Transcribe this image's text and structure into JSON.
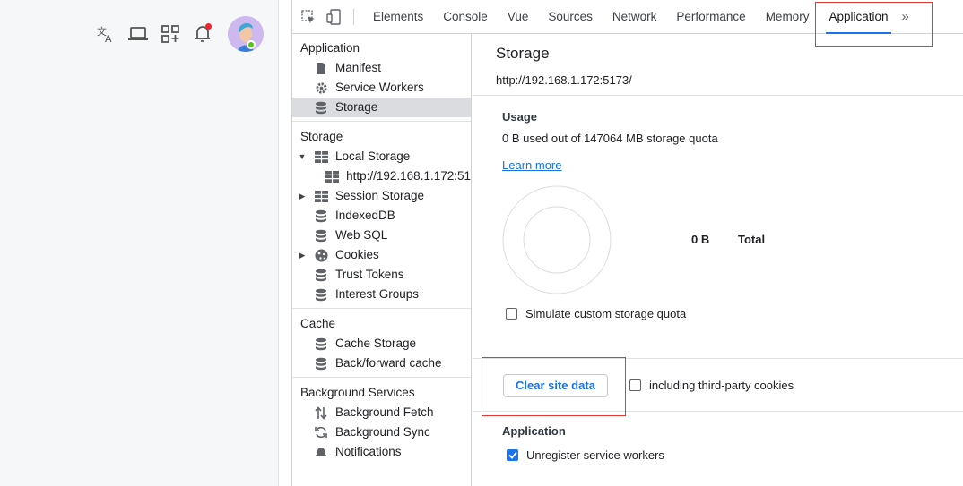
{
  "devtools": {
    "tabs": [
      "Elements",
      "Console",
      "Vue",
      "Sources",
      "Network",
      "Performance",
      "Memory",
      "Application"
    ],
    "active_tab": "Application",
    "more_label": "»"
  },
  "sidebar": {
    "application": {
      "title": "Application",
      "items": [
        "Manifest",
        "Service Workers",
        "Storage"
      ]
    },
    "storage": {
      "title": "Storage",
      "local_storage": "Local Storage",
      "local_origin": "http://192.168.1.172:51",
      "session_storage": "Session Storage",
      "indexeddb": "IndexedDB",
      "websql": "Web SQL",
      "cookies": "Cookies",
      "trust_tokens": "Trust Tokens",
      "interest_groups": "Interest Groups"
    },
    "cache": {
      "title": "Cache",
      "items": [
        "Cache Storage",
        "Back/forward cache"
      ]
    },
    "background": {
      "title": "Background Services",
      "items": [
        "Background Fetch",
        "Background Sync",
        "Notifications"
      ]
    }
  },
  "main": {
    "title": "Storage",
    "url": "http://192.168.1.172:5173/",
    "usage": {
      "heading": "Usage",
      "text": "0 B used out of 147064 MB storage quota",
      "learn_more": "Learn more",
      "total_value": "0 B",
      "total_label": "Total",
      "simulate_label": "Simulate custom storage quota"
    },
    "clear_button": "Clear site data",
    "third_party_label": "including third-party cookies",
    "application": {
      "heading": "Application",
      "unregister_label": "Unregister service workers"
    }
  },
  "colors": {
    "accent": "#1a73e8",
    "highlight_box": "#e53935",
    "notification_dot": "#f5222d",
    "online_dot": "#52c41a"
  }
}
